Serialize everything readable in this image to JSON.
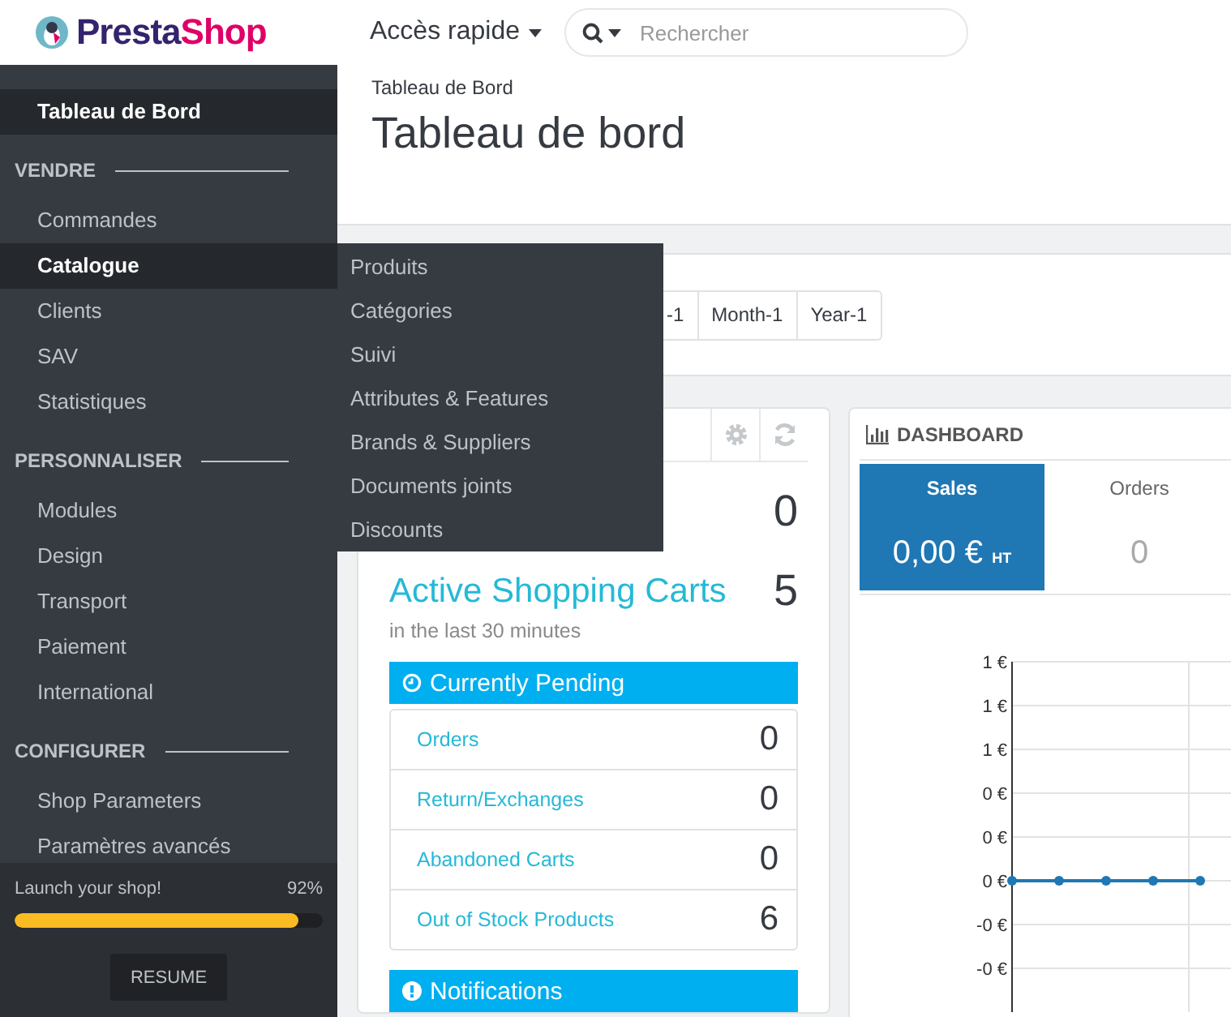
{
  "header": {
    "logo": [
      "Presta",
      "Shop"
    ],
    "quick_access": "Accès rapide",
    "search": {
      "placeholder": "Rechercher"
    }
  },
  "sidebar": {
    "items": [
      {
        "kind": "link",
        "label": "Tableau de Bord",
        "selected": true
      },
      {
        "kind": "section",
        "label": "VENDRE"
      },
      {
        "kind": "link",
        "label": "Commandes",
        "selected": false
      },
      {
        "kind": "link",
        "label": "Catalogue",
        "selected": true
      },
      {
        "kind": "link",
        "label": "Clients",
        "selected": false
      },
      {
        "kind": "link",
        "label": "SAV",
        "selected": false
      },
      {
        "kind": "link",
        "label": "Statistiques",
        "selected": false
      },
      {
        "kind": "section",
        "label": "PERSONNALISER"
      },
      {
        "kind": "link",
        "label": "Modules",
        "selected": false
      },
      {
        "kind": "link",
        "label": "Design",
        "selected": false
      },
      {
        "kind": "link",
        "label": "Transport",
        "selected": false
      },
      {
        "kind": "link",
        "label": "Paiement",
        "selected": false
      },
      {
        "kind": "link",
        "label": "International",
        "selected": false
      },
      {
        "kind": "section",
        "label": "CONFIGURER"
      },
      {
        "kind": "link",
        "label": "Shop Parameters",
        "selected": false
      },
      {
        "kind": "link",
        "label": "Paramètres avancés",
        "selected": false
      }
    ],
    "launch": {
      "label": "Launch your shop!",
      "percent": "92%",
      "level": 0.92,
      "button": "RESUME"
    }
  },
  "flyout": {
    "items": [
      "Produits",
      "Catégories",
      "Suivi",
      "Attributes & Features",
      "Brands & Suppliers",
      "Documents joints",
      "Discounts"
    ]
  },
  "page": {
    "breadcrumb": "Tableau de Bord",
    "title": "Tableau de bord"
  },
  "date_range": {
    "buttons": [
      "-1",
      "Month-1",
      "Year-1"
    ]
  },
  "activity": {
    "stats": [
      {
        "value": "0"
      },
      {
        "label": "Active Shopping Carts",
        "value": "5",
        "caption": "in the last 30 minutes"
      }
    ],
    "pending": {
      "title": "Currently Pending",
      "rows": [
        {
          "label": "Orders",
          "value": "0"
        },
        {
          "label": "Return/Exchanges",
          "value": "0"
        },
        {
          "label": "Abandoned Carts",
          "value": "0"
        },
        {
          "label": "Out of Stock Products",
          "value": "6"
        }
      ]
    },
    "notifications": {
      "title": "Notifications"
    }
  },
  "dashboard": {
    "title": "DASHBOARD",
    "kpis": [
      {
        "label": "Sales",
        "value": "0,00 €",
        "unit": "HT",
        "selected": true
      },
      {
        "label": "Orders",
        "value": "0",
        "selected": false
      }
    ],
    "chart_data": {
      "type": "line",
      "ylim": [
        -0.6,
        1
      ],
      "grid": true,
      "yticks": [
        {
          "value": 1,
          "label": "1 €"
        },
        {
          "value": 0.8,
          "label": "1 €"
        },
        {
          "value": 0.6,
          "label": "1 €"
        },
        {
          "value": 0.4,
          "label": "0 €"
        },
        {
          "value": 0.2,
          "label": "0 €"
        },
        {
          "value": 0,
          "label": "0 €"
        },
        {
          "value": -0.2,
          "label": "-0 €"
        },
        {
          "value": -0.4,
          "label": "-0 €"
        }
      ],
      "series": [
        {
          "color": "#1f77b4",
          "marker": "circle",
          "values": [
            0,
            0,
            0,
            0,
            0
          ]
        }
      ]
    }
  }
}
